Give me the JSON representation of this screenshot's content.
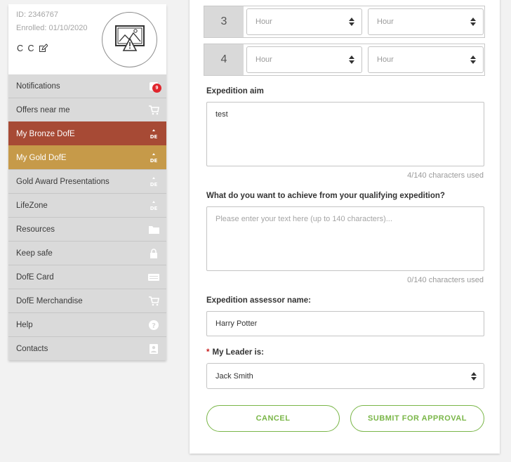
{
  "profile": {
    "id": "ID: 2346767",
    "enrolled": "Enrolled: 01/10/2020",
    "name": "C C"
  },
  "menu": [
    {
      "label": "Notifications",
      "icon": "notification-icon",
      "badge": "9"
    },
    {
      "label": "Offers near me",
      "icon": "cart-icon"
    },
    {
      "label": "My Bronze DofE",
      "icon": "dofe-logo-icon"
    },
    {
      "label": "My Gold DofE",
      "icon": "dofe-logo-icon"
    },
    {
      "label": "Gold Award Presentations",
      "icon": "dofe-logo-icon"
    },
    {
      "label": "LifeZone",
      "icon": "dofe-logo-icon"
    },
    {
      "label": "Resources",
      "icon": "folder-icon"
    },
    {
      "label": "Keep safe",
      "icon": "lock-icon"
    },
    {
      "label": "DofE Card",
      "icon": "card-icon"
    },
    {
      "label": "DofE Merchandise",
      "icon": "cart-icon"
    },
    {
      "label": "Help",
      "icon": "help-icon"
    },
    {
      "label": "Contacts",
      "icon": "contact-icon"
    }
  ],
  "colors": {
    "bronze": "#a74a35",
    "gold": "#c69a49",
    "accent_green": "#7ab648",
    "badge_red": "#e0262d"
  },
  "time_rows": [
    {
      "num": "3",
      "start_placeholder": "Hour",
      "end_placeholder": "Hour"
    },
    {
      "num": "4",
      "start_placeholder": "Hour",
      "end_placeholder": "Hour"
    }
  ],
  "form": {
    "aim_label": "Expedition aim",
    "aim_value": "test",
    "aim_counter": "4/140 characters used",
    "achieve_label": "What do you want to achieve from your qualifying expedition?",
    "achieve_placeholder": "Please enter your text here (up to 140 characters)...",
    "achieve_counter": "0/140 characters used",
    "assessor_label": "Expedition assessor name:",
    "assessor_value": "Harry Potter",
    "leader_required_mark": "*",
    "leader_label": "My Leader is:",
    "leader_value": "Jack Smith"
  },
  "buttons": {
    "cancel": "CANCEL",
    "submit": "SUBMIT FOR APPROVAL"
  }
}
